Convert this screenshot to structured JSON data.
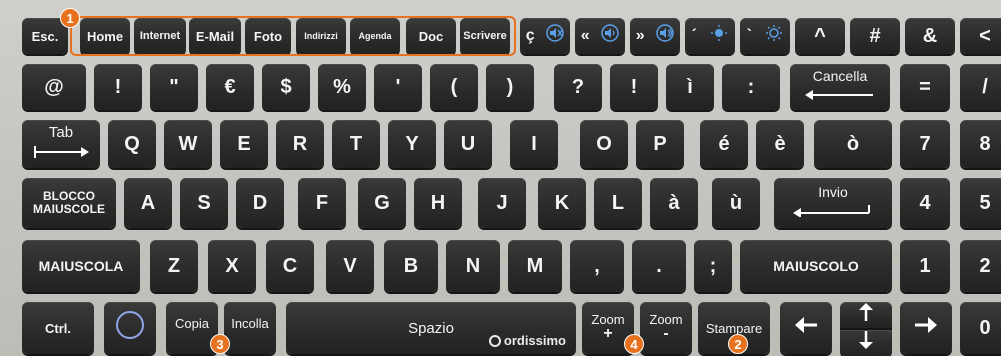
{
  "row1": {
    "esc": "Esc.",
    "home": "Home",
    "internet": "Internet",
    "email": "E-Mail",
    "foto": "Foto",
    "indirizzi": "Indirizzi",
    "agenda": "Agenda",
    "doc": "Doc",
    "scrivere": "Scrivere",
    "c_cedilla": "ç",
    "laquo": "«",
    "raquo": "»",
    "acute": "´",
    "grave": "`",
    "caret": "^",
    "hash": "#",
    "amp": "&",
    "lt": "<"
  },
  "row2": {
    "at": "@",
    "excl": "!",
    "quote": "\"",
    "euro": "€",
    "dollar": "$",
    "percent": "%",
    "apos": "'",
    "lparen": "(",
    "rparen": ")",
    "question": "?",
    "excl2": "!",
    "igrave": "ì",
    "colon": ":",
    "cancella": "Cancella",
    "equals": "=",
    "slash": "/"
  },
  "row3": {
    "tab": "Tab",
    "letters": [
      "Q",
      "W",
      "E",
      "R",
      "T",
      "Y",
      "U",
      "I",
      "O",
      "P"
    ],
    "eacute": "é",
    "egrave": "è",
    "ograve": "ò",
    "n7": "7",
    "n8": "8"
  },
  "row4": {
    "blocco1": "BLOCCO",
    "blocco2": "MAIUSCOLE",
    "letters": [
      "A",
      "S",
      "D",
      "F",
      "G",
      "H",
      "J",
      "K",
      "L"
    ],
    "agrave": "à",
    "ugrave": "ù",
    "invio": "Invio",
    "n4": "4",
    "n5": "5"
  },
  "row5": {
    "maiuscola": "MAIUSCOLA",
    "letters": [
      "Z",
      "X",
      "C",
      "V",
      "B",
      "N",
      "M"
    ],
    "comma": ",",
    "period": ".",
    "semicolon": ";",
    "maiuscolo": "MAIUSCOLO",
    "n1": "1",
    "n2": "2"
  },
  "row6": {
    "ctrl": "Ctrl.",
    "copia": "Copia",
    "incolla": "Incolla",
    "spazio": "Spazio",
    "brand": "ordissimo",
    "zoom_plus_1": "Zoom",
    "zoom_plus_2": "+",
    "zoom_minus_1": "Zoom",
    "zoom_minus_2": "-",
    "stampare": "Stampare",
    "n0": "0"
  },
  "badges": {
    "b1": "1",
    "b2": "2",
    "b3": "3",
    "b4": "4"
  },
  "colors": {
    "highlight": "#e8711e",
    "key": "#2a2a2a",
    "body": "#c8c8c4"
  }
}
